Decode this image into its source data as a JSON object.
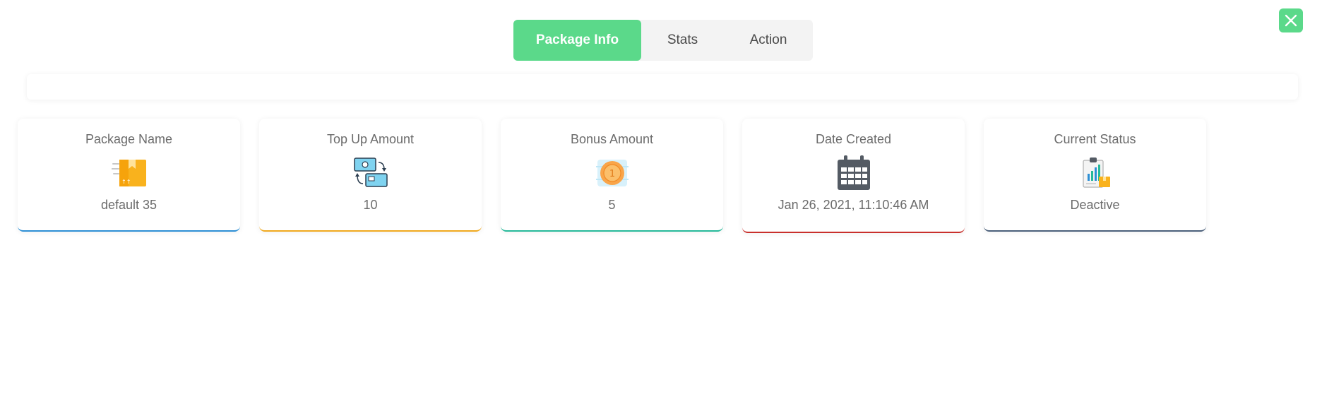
{
  "tabs": [
    {
      "label": "Package Info",
      "active": true
    },
    {
      "label": "Stats",
      "active": false
    },
    {
      "label": "Action",
      "active": false
    }
  ],
  "colors": {
    "accent": "#5bd98a",
    "card_borders": [
      "#2d8fd5",
      "#f0a91e",
      "#26b99a",
      "#c9302c",
      "#4a5f7a"
    ]
  },
  "cards": [
    {
      "title": "Package Name",
      "value": "default 35",
      "icon": "package-box-icon"
    },
    {
      "title": "Top Up Amount",
      "value": "10",
      "icon": "money-transfer-icon"
    },
    {
      "title": "Bonus Amount",
      "value": "5",
      "icon": "coin-icon"
    },
    {
      "title": "Date Created",
      "value": "Jan 26, 2021, 11:10:46 AM",
      "icon": "calendar-icon"
    },
    {
      "title": "Current Status",
      "value": "Deactive",
      "icon": "status-report-icon"
    }
  ]
}
